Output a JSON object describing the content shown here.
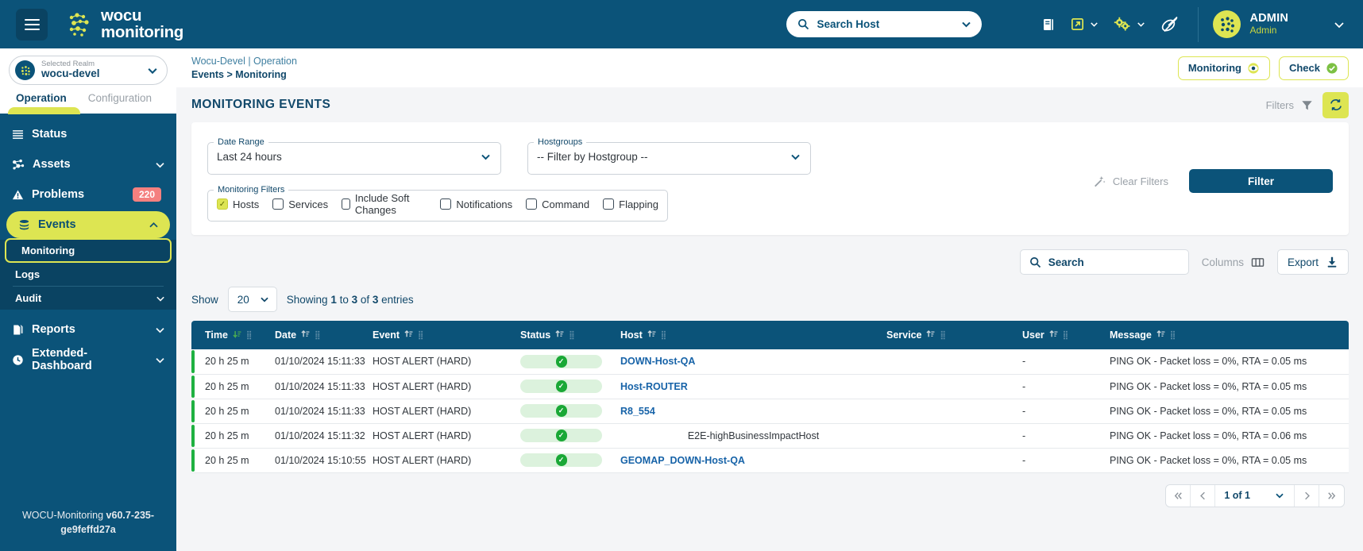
{
  "header": {
    "burger_icon": "hamburger-menu-icon",
    "brand_line1": "wocu",
    "brand_line2": "monitoring",
    "brand_logo_icon": "wocu-dots-logo-icon",
    "search": {
      "placeholder": "Search Host",
      "value": "",
      "icon": "search-icon",
      "caret_icon": "chevron-down-icon"
    },
    "icons": [
      {
        "name": "book-icon",
        "caret": false
      },
      {
        "name": "external-link-icon",
        "caret": true
      },
      {
        "name": "gears-icon",
        "caret": true
      },
      {
        "name": "satellite-dish-icon",
        "caret": false
      }
    ],
    "user": {
      "name": "ADMIN",
      "role": "Admin",
      "avatar_icon": "user-avatar-dots-icon",
      "caret_icon": "chevron-down-icon"
    },
    "colors": {
      "bar": "#0b5379",
      "accent_yellow": "#dde552"
    }
  },
  "sidebar": {
    "realm": {
      "label": "Selected Realm",
      "value": "wocu-devel",
      "icon": "realm-globe-icon",
      "caret_icon": "chevron-down-icon"
    },
    "tabs": [
      {
        "label": "Operation",
        "active": true
      },
      {
        "label": "Configuration",
        "active": false
      }
    ],
    "items": [
      {
        "label": "Status",
        "icon": "status-lines-icon",
        "caret": false,
        "badge": ""
      },
      {
        "label": "Assets",
        "icon": "assets-network-icon",
        "caret": true,
        "badge": ""
      },
      {
        "label": "Problems",
        "icon": "warning-triangle-icon",
        "caret": false,
        "badge": "220"
      },
      {
        "label": "Events",
        "icon": "events-stack-icon",
        "caret": true,
        "badge": "",
        "active": true
      },
      {
        "label": "Reports",
        "icon": "reports-document-icon",
        "caret": true,
        "badge": ""
      },
      {
        "label": "Extended-Dashboard",
        "icon": "dashboard-clock-icon",
        "caret": true,
        "badge": ""
      }
    ],
    "subitems": [
      {
        "label": "Monitoring",
        "selected": true,
        "caret": false
      },
      {
        "label": "Logs",
        "selected": false,
        "caret": false
      },
      {
        "label": "Audit",
        "selected": false,
        "caret": true
      }
    ],
    "footer_prefix": "WOCU-Monitoring ",
    "footer_version": "v60.7-235-ge9feffd27a"
  },
  "breadcrumb": {
    "top": "Wocu-Devel | Operation",
    "bottom": "Events > Monitoring",
    "actions": [
      {
        "label": "Monitoring",
        "icon": "eye-icon"
      },
      {
        "label": "Check",
        "icon": "check-circle-icon"
      }
    ]
  },
  "page": {
    "title": "MONITORING EVENTS",
    "filters_label": "Filters",
    "filters_icon": "funnel-icon",
    "refresh_icon": "refresh-sync-icon"
  },
  "filters": {
    "date_range": {
      "legend": "Date Range",
      "value": "Last 24 hours",
      "caret_icon": "chevron-down-icon"
    },
    "hostgroups": {
      "legend": "Hostgroups",
      "value": "-- Filter by Hostgroup --",
      "caret_icon": "chevron-down-icon"
    },
    "monitoring_filters": {
      "legend": "Monitoring Filters",
      "checkboxes": [
        {
          "label": "Hosts",
          "checked": true
        },
        {
          "label": "Services",
          "checked": false
        },
        {
          "label": "Include Soft Changes",
          "checked": false
        },
        {
          "label": "Notifications",
          "checked": false
        },
        {
          "label": "Command",
          "checked": false
        },
        {
          "label": "Flapping",
          "checked": false
        }
      ]
    },
    "clear_filters": {
      "label": "Clear Filters",
      "icon": "magic-wand-icon"
    },
    "filter_button": "Filter"
  },
  "toolbar": {
    "search": {
      "placeholder": "Search",
      "value": "",
      "icon": "search-icon"
    },
    "columns": {
      "label": "Columns",
      "icon": "columns-icon"
    },
    "export": {
      "label": "Export",
      "icon": "download-icon"
    }
  },
  "table_controls": {
    "show_label": "Show",
    "page_size": "20",
    "page_size_caret": "chevron-down-icon",
    "showing_prefix": "Showing ",
    "showing_from": "1",
    "showing_mid": " to ",
    "showing_to": "3",
    "showing_of": " of ",
    "showing_total": "3",
    "showing_suffix": " entries"
  },
  "table": {
    "columns": [
      {
        "label": "Time",
        "sort": "desc-active",
        "grip": true
      },
      {
        "label": "Date",
        "sort": "none",
        "grip": true
      },
      {
        "label": "Event",
        "sort": "none",
        "grip": true
      },
      {
        "label": "Status",
        "sort": "none",
        "grip": true
      },
      {
        "label": "Host",
        "sort": "none",
        "grip": true
      },
      {
        "label": "Service",
        "sort": "none",
        "grip": true
      },
      {
        "label": "User",
        "sort": "none",
        "grip": true
      },
      {
        "label": "Message",
        "sort": "none",
        "grip": true
      }
    ],
    "rows": [
      {
        "time": "20 h 25 m",
        "date": "01/10/2024 15:11:33",
        "event": "HOST ALERT (HARD)",
        "status": "ok",
        "status_icon": "check-oval-icon",
        "host": "DOWN-Host-QA",
        "host_is_link": true,
        "service": "",
        "user": "-",
        "message": "PING OK - Packet loss = 0%, RTA = 0.05 ms",
        "accent": "#1fb141"
      },
      {
        "time": "20 h 25 m",
        "date": "01/10/2024 15:11:33",
        "event": "HOST ALERT (HARD)",
        "status": "ok",
        "status_icon": "check-oval-icon",
        "host": "Host-ROUTER",
        "host_is_link": true,
        "service": "",
        "user": "-",
        "message": "PING OK - Packet loss = 0%, RTA = 0.05 ms",
        "accent": "#1fb141"
      },
      {
        "time": "20 h 25 m",
        "date": "01/10/2024 15:11:33",
        "event": "HOST ALERT (HARD)",
        "status": "ok",
        "status_icon": "check-oval-icon",
        "host": "R8_554",
        "host_is_link": true,
        "service": "",
        "user": "-",
        "message": "PING OK - Packet loss = 0%, RTA = 0.05 ms",
        "accent": "#1fb141"
      },
      {
        "time": "20 h 25 m",
        "date": "01/10/2024 15:11:32",
        "event": "HOST ALERT (HARD)",
        "status": "ok",
        "status_icon": "check-oval-icon",
        "host": "E2E-highBusinessImpactHost",
        "host_is_link": false,
        "service": "",
        "user": "-",
        "message": "PING OK - Packet loss = 0%, RTA = 0.06 ms",
        "accent": "#1fb141"
      },
      {
        "time": "20 h 25 m",
        "date": "01/10/2024 15:10:55",
        "event": "HOST ALERT (HARD)",
        "status": "ok",
        "status_icon": "check-oval-icon",
        "host": "GEOMAP_DOWN-Host-QA",
        "host_is_link": true,
        "service": "",
        "user": "-",
        "message": "PING OK - Packet loss = 0%, RTA = 0.05 ms",
        "accent": "#1fb141"
      }
    ]
  },
  "pagination": {
    "first_icon": "chevron-double-left-icon",
    "prev_icon": "chevron-left-icon",
    "page_text": "1 of 1",
    "page_caret_icon": "chevron-down-icon",
    "next_icon": "chevron-right-icon",
    "last_icon": "chevron-double-right-icon"
  }
}
